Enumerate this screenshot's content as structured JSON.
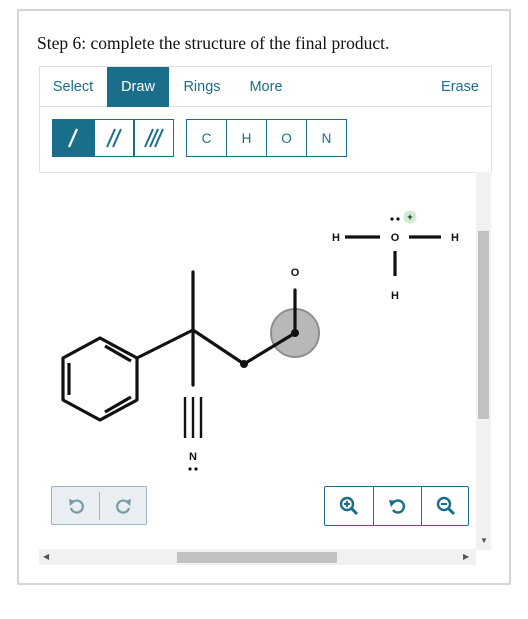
{
  "question": {
    "title": "Step 6: complete the structure of the final product."
  },
  "tabs": [
    {
      "label": "Select",
      "active": false
    },
    {
      "label": "Draw",
      "active": true
    },
    {
      "label": "Rings",
      "active": false
    },
    {
      "label": "More",
      "active": false
    }
  ],
  "erase_label": "Erase",
  "bond_tools": [
    "single-bond",
    "double-bond",
    "triple-bond"
  ],
  "atom_tools": [
    "C",
    "H",
    "O",
    "N"
  ],
  "canvas": {
    "atoms": {
      "oxygen_aldehyde": "O",
      "nitrogen": "N",
      "hydrogen_left": "H",
      "oxygen_center": "O",
      "hydrogen_right": "H",
      "hydrogen_bottom": "H",
      "charge": "+"
    }
  },
  "colors": {
    "accent": "#1b6e8a",
    "charge_badge": "#cfeccf",
    "selection": "#b8b8b8"
  }
}
